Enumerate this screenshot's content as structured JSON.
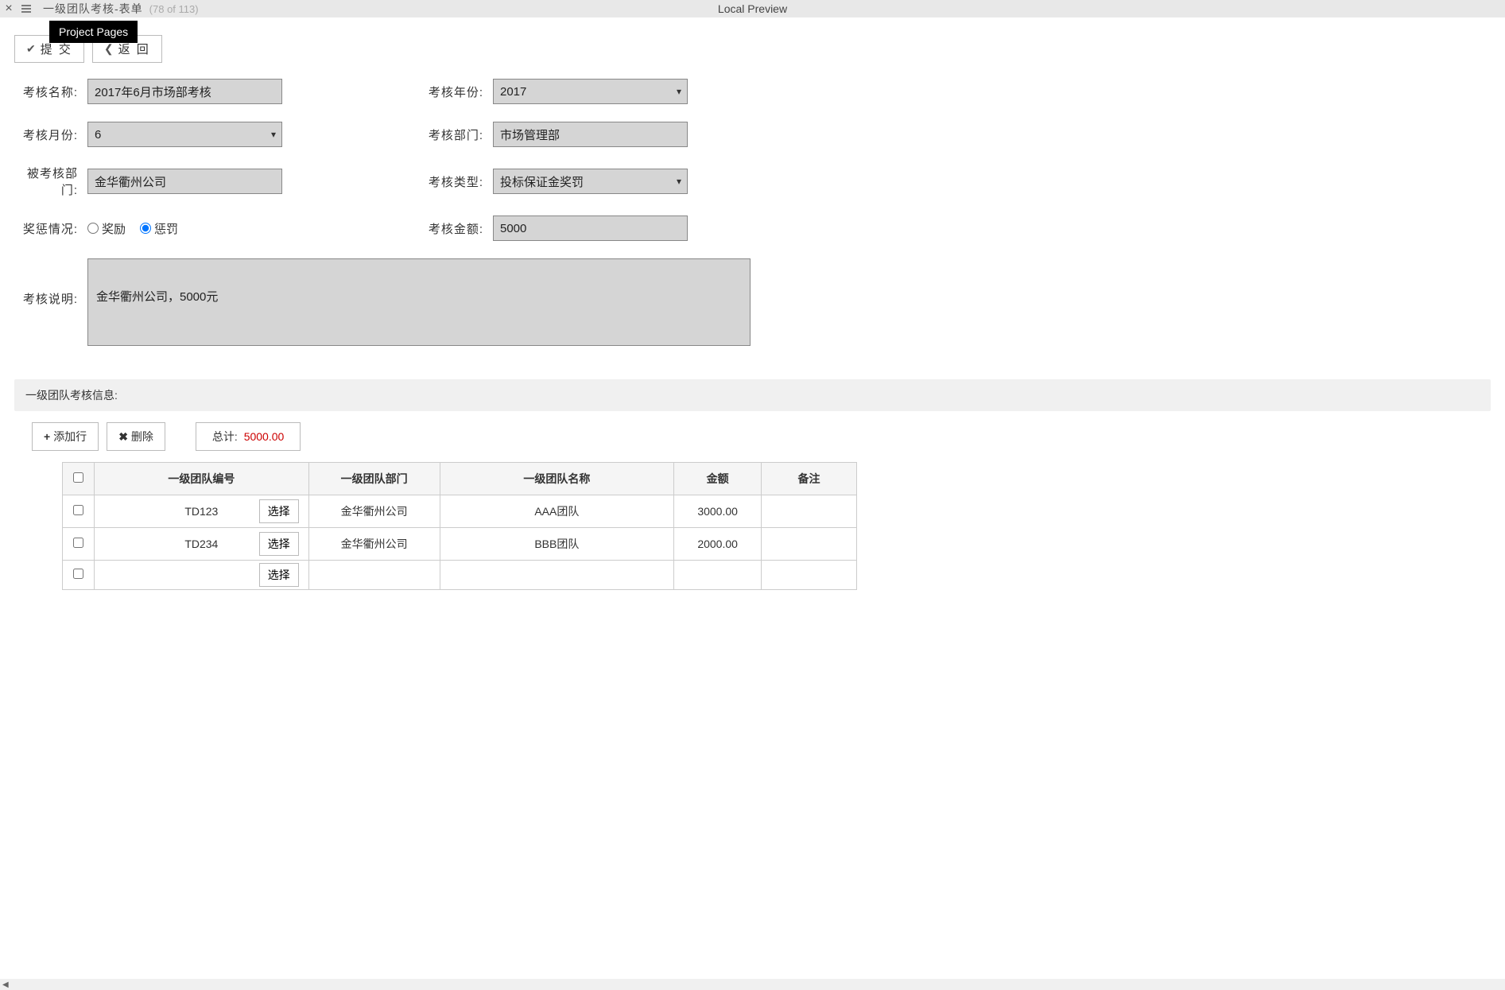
{
  "header": {
    "title": "一级团队考核-表单",
    "pagecount": "(78 of 113)",
    "preview": "Local Preview",
    "tooltip": "Project Pages"
  },
  "toolbar": {
    "submit": "提 交",
    "back": "返 回"
  },
  "form": {
    "labels": {
      "name": "考核名称:",
      "year": "考核年份:",
      "month": "考核月份:",
      "dept": "考核部门:",
      "target": "被考核部门:",
      "type": "考核类型:",
      "reward_punish": "奖惩情况:",
      "amount": "考核金额:",
      "desc": "考核说明:"
    },
    "values": {
      "name": "2017年6月市场部考核",
      "year": "2017",
      "month": "6",
      "dept": "市场管理部",
      "target": "金华衢州公司",
      "type": "投标保证金奖罚",
      "amount": "5000",
      "desc": "金华衢州公司，5000元"
    },
    "radio": {
      "reward": "奖励",
      "punish": "惩罚"
    }
  },
  "section": {
    "title": "一级团队考核信息:"
  },
  "table_toolbar": {
    "add": "添加行",
    "delete": "删除",
    "total_label": "总计:",
    "total_value": "5000.00"
  },
  "table": {
    "headers": {
      "code": "一级团队编号",
      "dept": "一级团队部门",
      "name": "一级团队名称",
      "amount": "金额",
      "note": "备注"
    },
    "select_btn": "选择",
    "rows": [
      {
        "code": "TD123",
        "dept": "金华衢州公司",
        "name": "AAA团队",
        "amount": "3000.00",
        "note": ""
      },
      {
        "code": "TD234",
        "dept": "金华衢州公司",
        "name": "BBB团队",
        "amount": "2000.00",
        "note": ""
      },
      {
        "code": "",
        "dept": "",
        "name": "",
        "amount": "",
        "note": ""
      }
    ]
  }
}
